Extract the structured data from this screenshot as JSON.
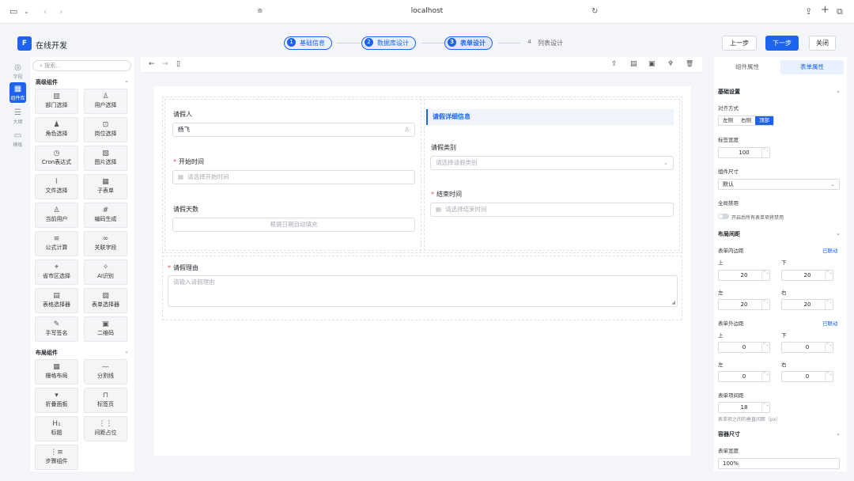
{
  "browser": {
    "url": "localhost"
  },
  "app": {
    "logo_letter": "F",
    "title": "在线开发"
  },
  "steps": [
    {
      "num": "1",
      "label": "基础信息",
      "state": "done"
    },
    {
      "num": "2",
      "label": "数据库设计",
      "state": "done"
    },
    {
      "num": "3",
      "label": "表单设计",
      "state": "active"
    },
    {
      "num": "4",
      "label": "列表设计",
      "state": "todo"
    }
  ],
  "header_buttons": {
    "prev": "上一步",
    "next": "下一步",
    "close": "关闭"
  },
  "rail": [
    {
      "label": "字段",
      "icon": "◎"
    },
    {
      "label": "组件库",
      "icon": "▦"
    },
    {
      "label": "大纲",
      "icon": "☰"
    },
    {
      "label": "模板",
      "icon": "▭"
    }
  ],
  "panel": {
    "search_placeholder": "搜索...",
    "sections": [
      {
        "title": "高级组件",
        "chevron": "⌄"
      },
      {
        "title": "布局组件",
        "chevron": "⌄"
      }
    ],
    "components": [
      {
        "label": "部门选择",
        "icon": "▥"
      },
      {
        "label": "用户选择",
        "icon": "♙"
      },
      {
        "label": "角色选择",
        "icon": "♟"
      },
      {
        "label": "岗位选择",
        "icon": "⊡"
      },
      {
        "label": "Cron表达式",
        "icon": "◷"
      },
      {
        "label": "图片选择",
        "icon": "▨"
      },
      {
        "label": "文件选择",
        "icon": "⌇"
      },
      {
        "label": "子表单",
        "icon": "▦"
      },
      {
        "label": "当前用户",
        "icon": "♙"
      },
      {
        "label": "编码生成",
        "icon": "#"
      },
      {
        "label": "公式计算",
        "icon": "≡"
      },
      {
        "label": "关联字段",
        "icon": "∞"
      },
      {
        "label": "省市区选择",
        "icon": "⌖"
      },
      {
        "label": "AI识别",
        "icon": "✧"
      },
      {
        "label": "表格选择器",
        "icon": "▤"
      },
      {
        "label": "表单选择器",
        "icon": "▧"
      },
      {
        "label": "手写签名",
        "icon": "✎"
      },
      {
        "label": "二维码",
        "icon": "▣"
      }
    ],
    "layout_components": [
      {
        "label": "栅格布局",
        "icon": "▦"
      },
      {
        "label": "分割线",
        "icon": "—"
      },
      {
        "label": "折叠面板",
        "icon": "▾"
      },
      {
        "label": "标签页",
        "icon": "⊓"
      },
      {
        "label": "标题",
        "icon": "H₁"
      },
      {
        "label": "间距占位",
        "icon": "⋮⋮"
      },
      {
        "label": "步骤组件",
        "icon": "⋮≡"
      }
    ]
  },
  "canvas_tools": {
    "back": "←",
    "forward": "→",
    "mobile": "▯",
    "upload": "⇪",
    "doc": "▤",
    "save": "▣",
    "clean": "♆",
    "delete": "🗑"
  },
  "form": {
    "applicant": {
      "label": "请假人",
      "value": "杨飞",
      "icon": "♙"
    },
    "start_time": {
      "label": "开始时间",
      "required_mark": "*",
      "placeholder": "请选择开始时间",
      "icon": "▦"
    },
    "days": {
      "label": "请假天数",
      "placeholder": "根据日期自动填充"
    },
    "detail_title": "请假详细信息",
    "leave_type": {
      "label": "请假类别",
      "placeholder": "请选择请假类别",
      "chevron": "⌄"
    },
    "end_time": {
      "label": "结束时间",
      "required_mark": "*",
      "placeholder": "请选择结束时间",
      "icon": "▦"
    },
    "reason": {
      "label": "请假理由",
      "required_mark": "*",
      "placeholder": "请输入请假理由"
    }
  },
  "props": {
    "tabs": [
      "组件属性",
      "表单属性"
    ],
    "basic_title": "基础设置",
    "align_label": "对齐方式",
    "align_options": [
      "左侧",
      "右侧",
      "顶部"
    ],
    "align_selected": 2,
    "label_width_label": "标签宽度",
    "label_width": "100",
    "size_label": "组件尺寸",
    "size_value": "默认",
    "disable_label": "全局禁用",
    "disable_hint": "开启后所有表单项将禁用",
    "layout_title": "布局间距",
    "inner_pad_label": "表单内边距",
    "linked": "已联动",
    "pad_top_label": "上",
    "pad_bottom_label": "下",
    "pad_left_label": "左",
    "pad_right_label": "右",
    "inner_pad": {
      "top": "20",
      "bottom": "20",
      "left": "20",
      "right": "20"
    },
    "outer_pad_label": "表单外边距",
    "outer_pad": {
      "top": "0",
      "bottom": "0",
      "left": "0",
      "right": "0"
    },
    "gap_label": "表单项间距",
    "gap_value": "18",
    "gap_hint": "表单项之间的垂直间距（px）",
    "container_title": "容器尺寸",
    "form_width_label": "表单宽度",
    "form_width": "100%",
    "chevron": "⌄",
    "stepper": "⌃⌄"
  },
  "colors": {
    "primary": "#1d63ed",
    "required": "#e5484d",
    "canvas_bg": "#f3f5f9"
  }
}
